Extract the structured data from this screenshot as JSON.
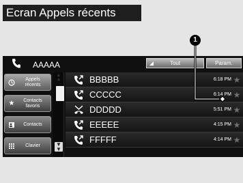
{
  "page_title": "Ecran Appels récents",
  "callout_number": "1",
  "topbar": {
    "device_name": "AAAAA",
    "btn_all": "Tout",
    "btn_settings": "Param."
  },
  "sidebar": {
    "items": [
      {
        "label": "Appels\nrécents",
        "icon": "clock-icon"
      },
      {
        "label": "Contacts\nfavoris",
        "icon": "star-icon"
      },
      {
        "label": "Contacts",
        "icon": "contacts-icon"
      },
      {
        "label": "Clavier",
        "icon": "keypad-icon"
      }
    ]
  },
  "calls": [
    {
      "name": "BBBBB",
      "time": "6:18 PM",
      "type": "outgoing"
    },
    {
      "name": "CCCCC",
      "time": "6:14 PM",
      "type": "outgoing"
    },
    {
      "name": "DDDDD",
      "time": "5:51 PM",
      "type": "missed"
    },
    {
      "name": "EEEEE",
      "time": "4:15 PM",
      "type": "outgoing"
    },
    {
      "name": "FFFFF",
      "time": "4:14 PM",
      "type": "outgoing"
    }
  ]
}
